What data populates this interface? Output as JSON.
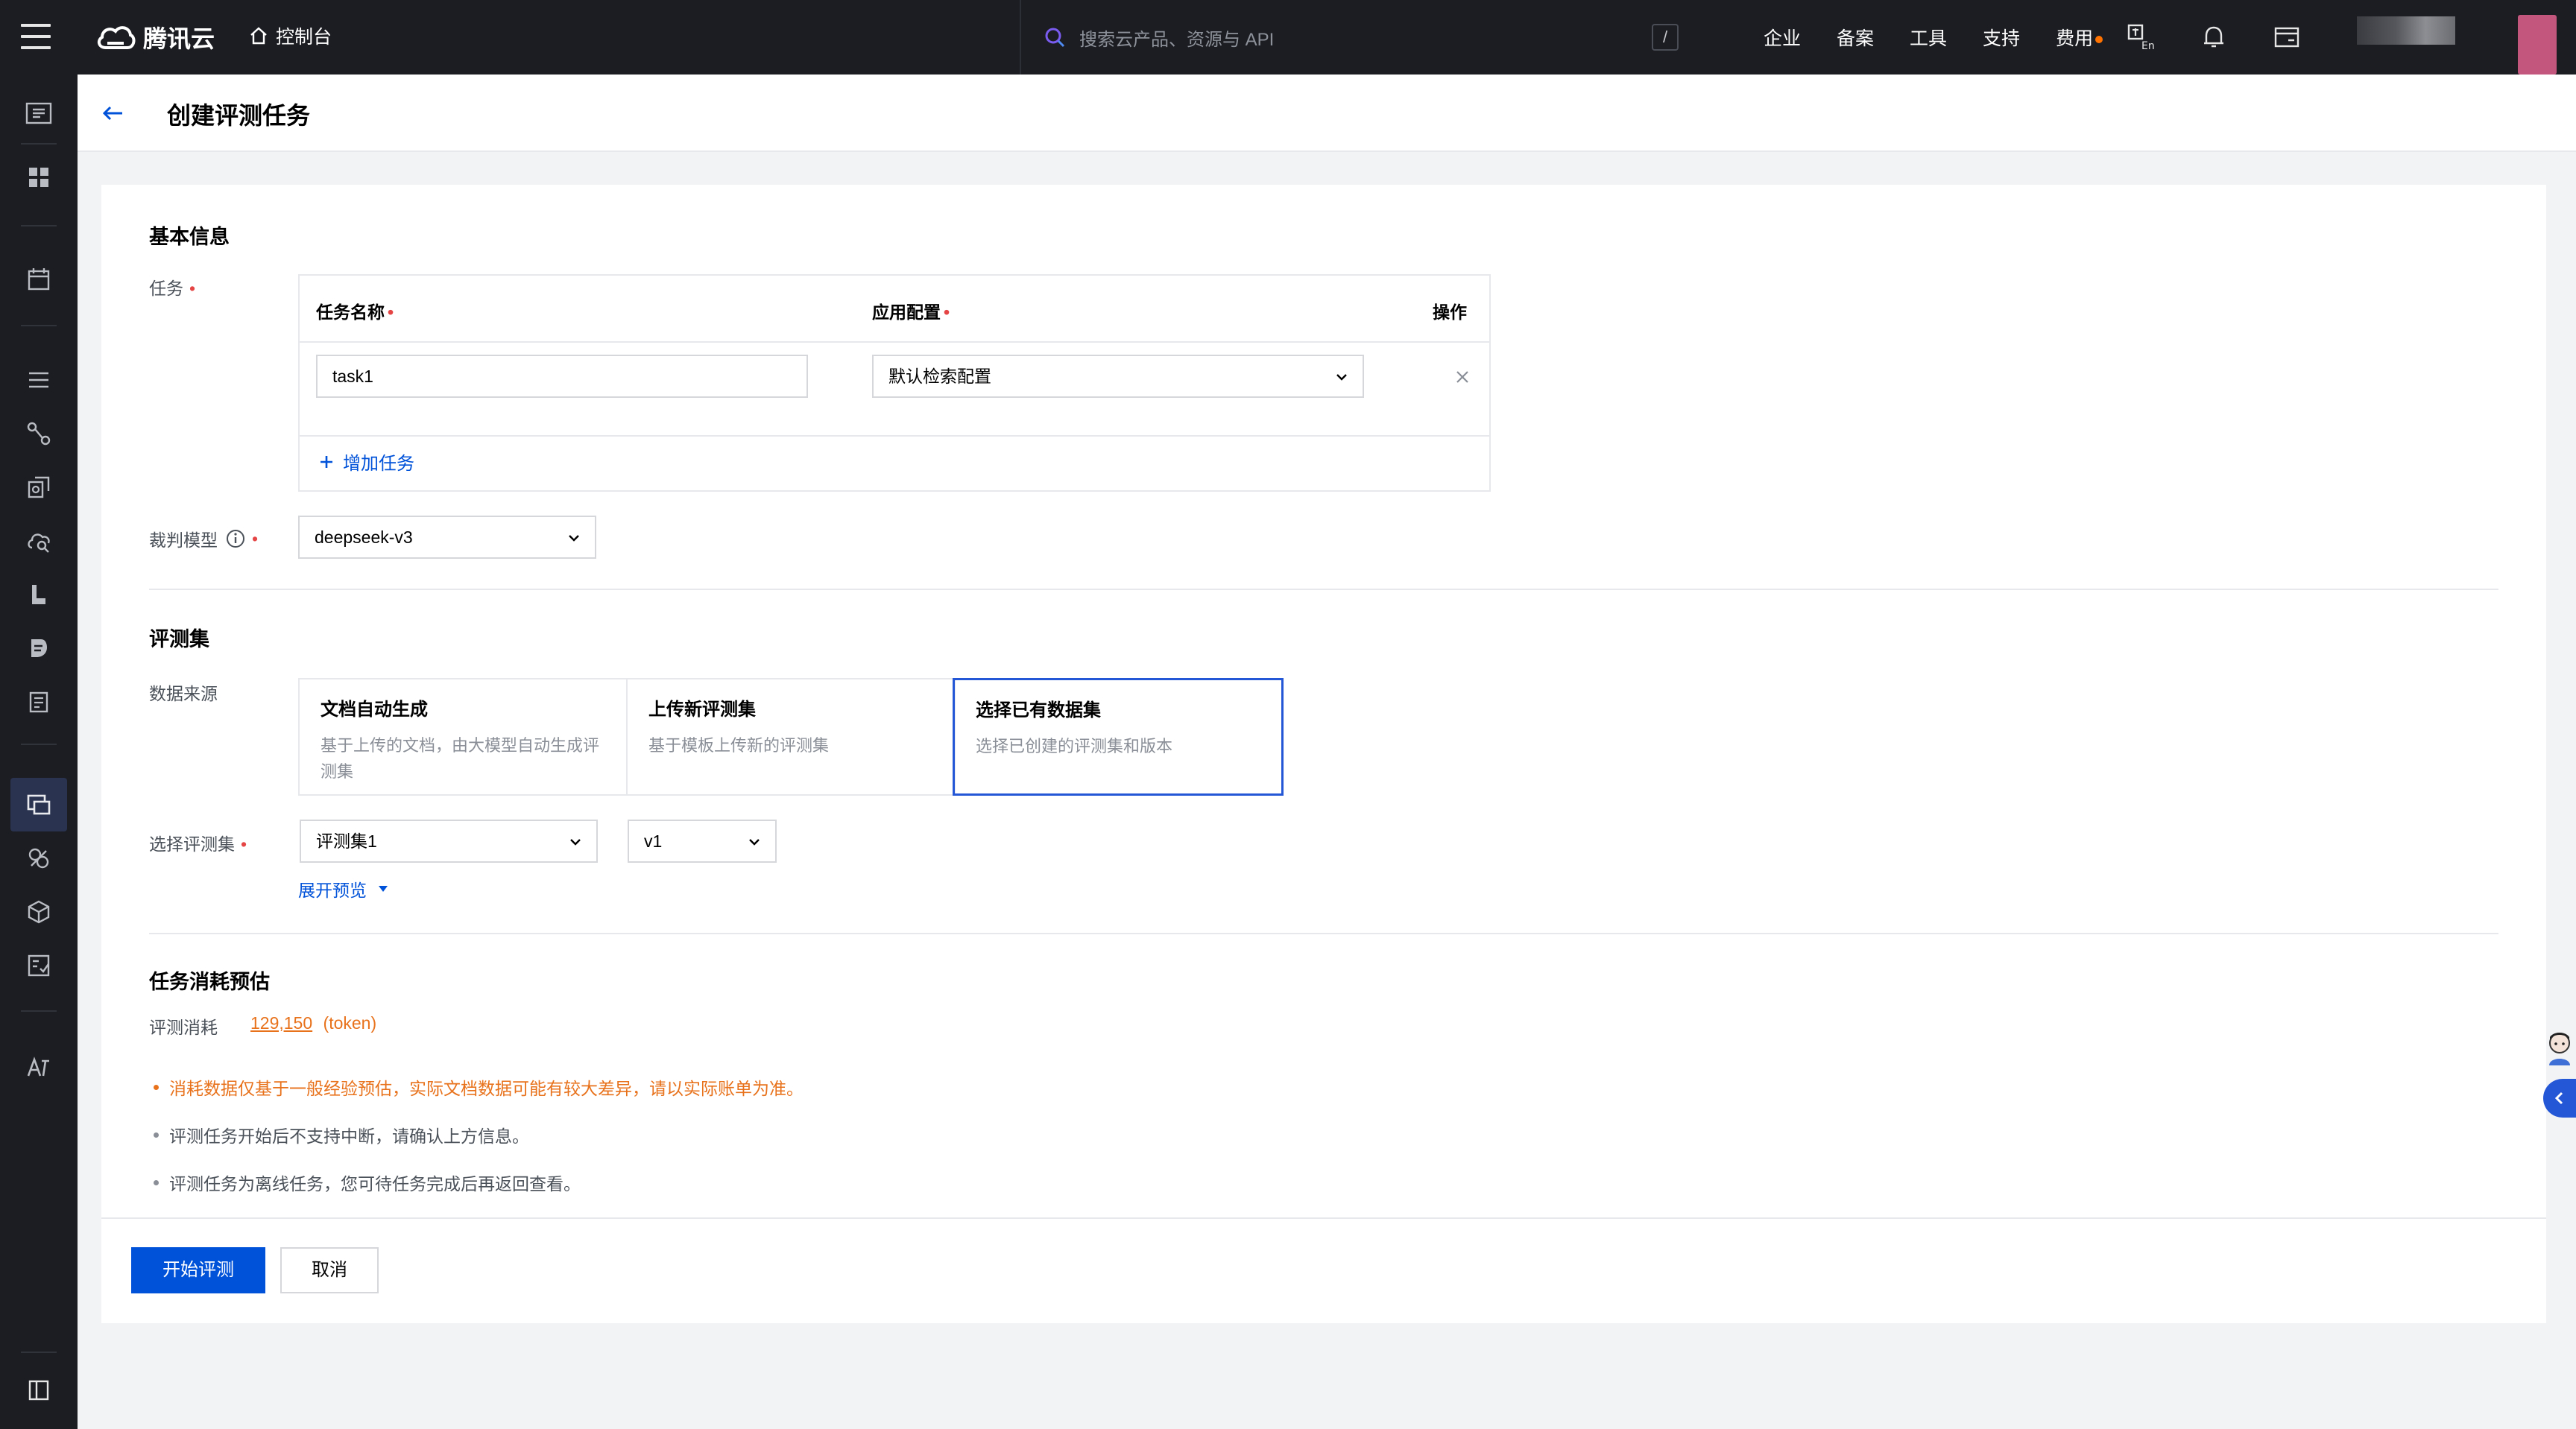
{
  "topbar": {
    "brand": "腾讯云",
    "console_label": "控制台",
    "search_placeholder": "搜索云产品、资源与 API",
    "slash_hint": "/",
    "nav": [
      "企业",
      "备案",
      "工具",
      "支持",
      "费用"
    ],
    "icons": [
      "menu-icon",
      "cloud-logo-icon",
      "home-icon",
      "search-icon",
      "translate-icon",
      "bell-icon",
      "ticket-icon"
    ]
  },
  "rail": {
    "icons": [
      "overview-icon",
      "grid-icon",
      "calendar-icon",
      "list-icon",
      "flow-icon",
      "sync-icon",
      "cloud-search-icon",
      "document-icon",
      "file-icon",
      "book-icon",
      "evaluate-icon",
      "plugin-icon",
      "cube-icon",
      "checklist-icon",
      "ai-text-icon",
      "panel-toggle-icon"
    ],
    "active_index": 10
  },
  "header": {
    "title": "创建评测任务"
  },
  "basic_info": {
    "title": "基本信息",
    "task_label": "任务",
    "columns": {
      "name": "任务名称",
      "config": "应用配置",
      "action": "操作"
    },
    "rows": [
      {
        "name": "task1",
        "config": "默认检索配置"
      }
    ],
    "add_task": "增加任务",
    "judge_label": "裁判模型",
    "judge_value": "deepseek-v3"
  },
  "eval_set": {
    "title": "评测集",
    "source_label": "数据来源",
    "sources": [
      {
        "title": "文档自动生成",
        "desc": "基于上传的文档，由大模型自动生成评测集",
        "selected": false
      },
      {
        "title": "上传新评测集",
        "desc": "基于模板上传新的评测集",
        "selected": false
      },
      {
        "title": "选择已有数据集",
        "desc": "选择已创建的评测集和版本",
        "selected": true
      }
    ],
    "select_label": "选择评测集",
    "set_value": "评测集1",
    "version_value": "v1",
    "preview_link": "展开预览"
  },
  "estimate": {
    "title": "任务消耗预估",
    "label": "评测消耗",
    "value": "129,150",
    "unit": "(token)",
    "notes": [
      "消耗数据仅基于一般经验预估，实际文档数据可能有较大差异，请以实际账单为准。",
      "评测任务开始后不支持中断，请确认上方信息。",
      "评测任务为离线任务，您可待任务完成后再返回查看。"
    ]
  },
  "actions": {
    "start": "开始评测",
    "cancel": "取消"
  },
  "colors": {
    "primary": "#0052d9",
    "warning": "#e8721c",
    "required": "#e54545",
    "topbar_bg": "#1b1d22"
  }
}
